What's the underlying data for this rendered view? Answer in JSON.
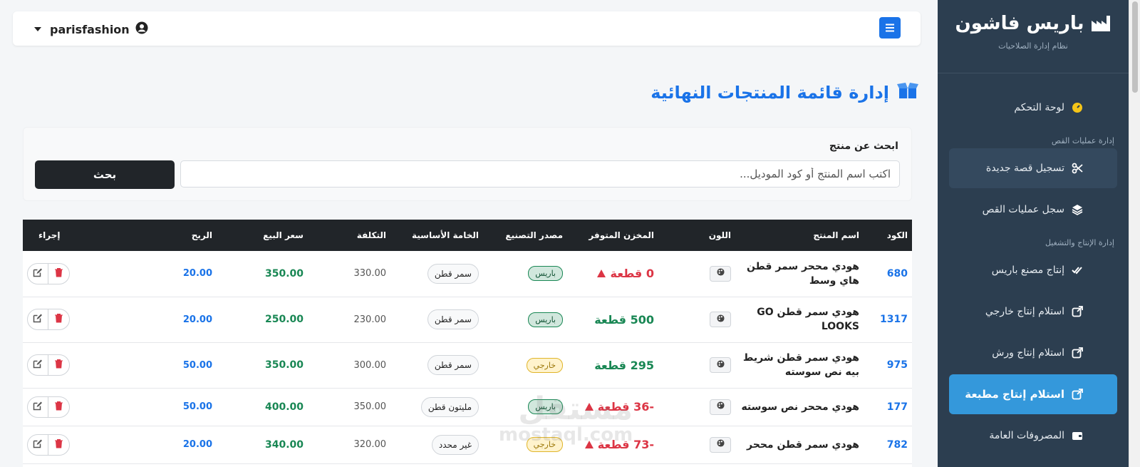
{
  "sidebar": {
    "brand_title": "باريس فاشون",
    "brand_subtitle": "نظام إدارة الصلاحيات",
    "dashboard": "لوحة التحكم",
    "section_cutting": "إدارة عمليات القص",
    "new_cut": "تسجيل قصة جديدة",
    "cut_log": "سجل عمليات القص",
    "section_production": "إدارة الإنتاج والتشغيل",
    "paris_factory": "إنتاج مصنع باريس",
    "external_receive": "استلام إنتاج خارجي",
    "workshop_receive": "استلام إنتاج ورش",
    "printed_receive": "استلام إنتاج مطبعة",
    "expenses": "المصروفات العامة"
  },
  "topbar": {
    "username": "parisfashion"
  },
  "page": {
    "title": "إدارة قائمة المنتجات النهائية"
  },
  "search": {
    "label": "ابحث عن منتج",
    "placeholder": "اكتب اسم المنتج أو كود الموديل...",
    "button": "بحث"
  },
  "table": {
    "headers": {
      "code": "الكود",
      "name": "اسم المنتج",
      "color": "اللون",
      "stock": "المخزن المتوفر",
      "source": "مصدر التصنيع",
      "material": "الخامة الأساسية",
      "cost": "التكلفة",
      "price": "سعر البيع",
      "profit": "الربح",
      "action": "إجراء"
    },
    "rows": [
      {
        "code": "680",
        "name": "هودي مححر سمر قطن هاي وسط",
        "stock": "0 قطعة",
        "source": "باريس",
        "material": "سمر قطن",
        "cost": "330.00",
        "price": "350.00",
        "profit": "20.00"
      },
      {
        "code": "1317",
        "name": "هودي سمر قطن GO LOOKS",
        "stock": "500 قطعة",
        "source": "باريس",
        "material": "سمر قطن",
        "cost": "230.00",
        "price": "250.00",
        "profit": "20.00"
      },
      {
        "code": "975",
        "name": "هودي سمر قطن شريط بيه نص سوسته",
        "stock": "295 قطعة",
        "source": "خارجي",
        "material": "سمر قطن",
        "cost": "300.00",
        "price": "350.00",
        "profit": "50.00"
      },
      {
        "code": "177",
        "name": "هودي مححر نص سوسته",
        "stock": "-36 قطعة",
        "source": "باريس",
        "material": "مليتون قطن",
        "cost": "350.00",
        "price": "400.00",
        "profit": "50.00"
      },
      {
        "code": "782",
        "name": "هودي سمر قطن مححر",
        "stock": "-73 قطعة",
        "source": "خارجي",
        "material": "غير محدد",
        "cost": "320.00",
        "price": "340.00",
        "profit": "20.00"
      }
    ]
  },
  "watermark": {
    "arabic": "مستقل",
    "latin": "mostaql.com"
  },
  "colors": {
    "sidebar": "#2c3e50",
    "active": "#3498db",
    "primary": "#1a73e8",
    "success": "#198754",
    "danger": "#dc3545"
  }
}
